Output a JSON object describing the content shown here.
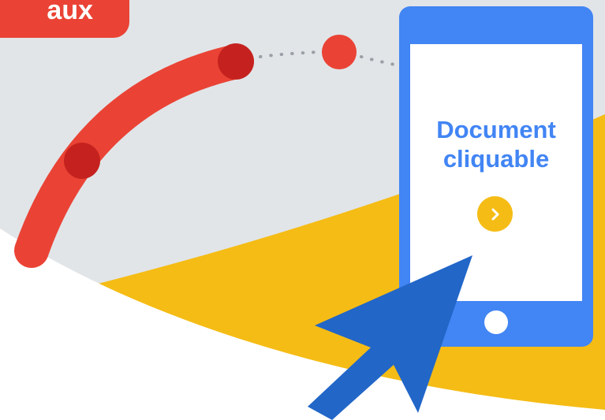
{
  "labels": {
    "tag_text": "aux",
    "document_line1": "Document",
    "document_line2": "cliquable"
  },
  "icons": {
    "next": "chevron-right-icon",
    "home": "home-button-icon",
    "cursor": "mouse-pointer-icon"
  },
  "colors": {
    "background_gray": "#e1e5e8",
    "yellow": "#f5bc15",
    "red": "#ea4335",
    "dark_red": "#c5221f",
    "phone_blue": "#4285f4",
    "cursor_blue": "#2266c8",
    "screen_white": "#ffffff",
    "text_white": "#ffffff",
    "text_blue": "#4285f4",
    "dot_gray": "#9aa0a6"
  }
}
